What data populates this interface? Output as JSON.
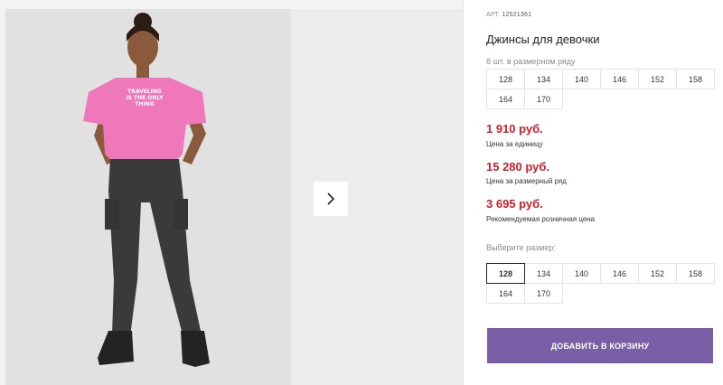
{
  "gallery": {
    "next_arrow_icon": "chevron-right-icon",
    "shirt_print": [
      "TRAVELING",
      "IS THE ONLY",
      "THING"
    ]
  },
  "product": {
    "sku_label": "АРТ.",
    "sku_value": "12521361",
    "title": "Джинсы для девочки",
    "pack_label": "8 шт. в размерном ряду",
    "pack_sizes": [
      "128",
      "134",
      "140",
      "146",
      "152",
      "158",
      "164",
      "170"
    ],
    "price_unit": "1 910 руб.",
    "price_unit_caption": "Цена за единицу",
    "price_pack": "15 280 руб.",
    "price_pack_caption": "Цена за размерный ряд",
    "price_retail": "3 695 руб.",
    "price_retail_caption": "Рекомендуемая розничная цена",
    "choose_size_label": "Выберите размер:",
    "sizes": [
      "128",
      "134",
      "140",
      "146",
      "152",
      "158",
      "164",
      "170"
    ],
    "selected_size": "128",
    "add_to_cart_label": "ДОБАВИТЬ В КОРЗИНУ"
  },
  "colors": {
    "price": "#d0202a",
    "button": "#7a5fa6",
    "shirt": "#ee78b9",
    "jeans": "#3a3a3a"
  }
}
